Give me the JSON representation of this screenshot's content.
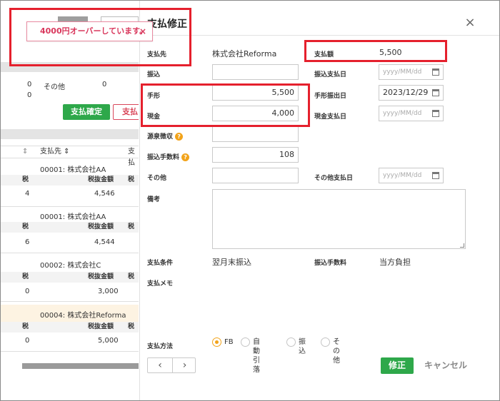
{
  "toast": {
    "message": "4000円オーバーしています。",
    "close": "×"
  },
  "background": {
    "summary": {
      "other_label": "その他",
      "zero_a": "0",
      "zero_b": "0"
    },
    "confirm_button": "支払確定",
    "pay_button": "支払",
    "table_header": {
      "vendor": "支払先 ⇕",
      "next": "支払"
    },
    "sub_headers": {
      "tax_left": "税",
      "amount": "税抜金額",
      "tax_right": "税"
    },
    "rows": [
      {
        "vendor": "00001: 株式会社AA",
        "left": "4",
        "amount": "4,546"
      },
      {
        "vendor": "00001: 株式会社AA",
        "left": "6",
        "amount": "4,544"
      },
      {
        "vendor": "00002: 株式会社C",
        "left": "0",
        "amount": "3,000"
      },
      {
        "vendor": "00004: 株式会社Reforma",
        "left": "0",
        "amount": "5,000"
      }
    ]
  },
  "modal": {
    "title": "支払修正",
    "close_icon": "×",
    "labels": {
      "payee": "支払先",
      "payment_amount": "支払額",
      "transfer": "振込",
      "transfer_date": "振込支払日",
      "bill": "手形",
      "bill_date": "手形振出日",
      "cash": "現金",
      "cash_date": "現金支払日",
      "withholding": "源泉徴収",
      "transfer_fee": "振込手数料",
      "other": "その他",
      "other_date": "その他支払日",
      "remarks": "備考",
      "payment_terms": "支払条件",
      "transfer_fee2": "振込手数料",
      "payment_memo": "支払メモ",
      "payment_method": "支払方法"
    },
    "values": {
      "payee": "株式会社Reforma",
      "payment_amount": "5,500",
      "transfer": "",
      "bill": "5,500",
      "cash": "4,000",
      "withholding": "",
      "transfer_fee": "108",
      "other": "",
      "payment_terms": "翌月末振込",
      "fee_bearer": "当方負担"
    },
    "dates": {
      "placeholder": "yyyy/MM/dd",
      "bill_date": "2023/12/29"
    },
    "help_icon": "?",
    "payment_methods": [
      "FB",
      "自動引落",
      "振込",
      "その他"
    ],
    "selected_method": "FB",
    "pager": {
      "prev": "‹",
      "next": "›"
    },
    "save_button": "修正",
    "cancel_button": "キャンセル"
  },
  "colors": {
    "accent_green": "#2ea84a",
    "alert_red": "#e5202d",
    "toast_pink": "#d9375c",
    "help_orange": "#f2a31a"
  }
}
